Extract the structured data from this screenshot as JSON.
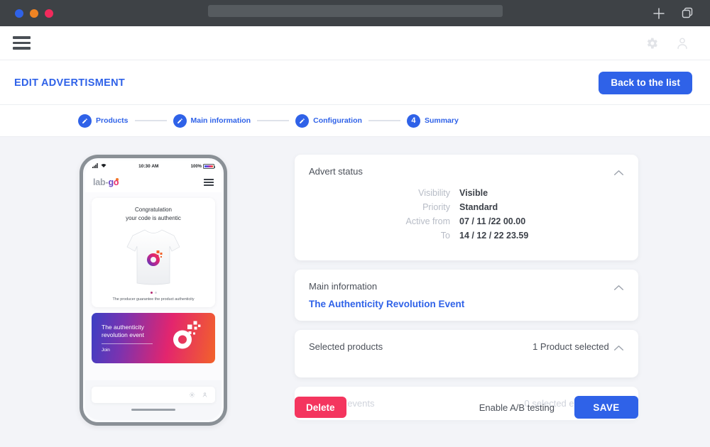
{
  "browser": {
    "traffic_lights": [
      "#2f62e8",
      "#f08423",
      "#f22a5c"
    ],
    "url_value": "",
    "new_tab_icon": "plus-icon",
    "tabs_icon": "copy-tabs-icon"
  },
  "appbar": {
    "menu_icon": "hamburger-menu-icon",
    "settings_icon": "gear-icon",
    "account_icon": "user-icon"
  },
  "header": {
    "title": "EDIT ADVERTISMENT",
    "back_button": "Back to the list",
    "accent_color": "#2f62e8"
  },
  "stepper": {
    "steps": [
      {
        "label": "Products",
        "marker": "pencil-icon",
        "done": true
      },
      {
        "label": "Main information",
        "marker": "pencil-icon",
        "done": true
      },
      {
        "label": "Configuration",
        "marker": "pencil-icon",
        "done": true
      },
      {
        "label": "Summary",
        "marker": "4",
        "done": false
      }
    ]
  },
  "phone": {
    "status_bar": {
      "time": "10:30 AM",
      "battery_text": "100%",
      "signal_icon": "signal-bars-icon",
      "wifi_icon": "wifi-icon",
      "battery_icon": "battery-icon"
    },
    "nav": {
      "logo_part1": "lab-",
      "logo_part2": "g",
      "logo_part3": "o",
      "menu_icon": "hamburger-menu-icon"
    },
    "product_card": {
      "title_line1": "Congratulation",
      "title_line2": "your code is authentic",
      "image": "tshirt-image",
      "carousel_dots": 2,
      "carousel_active": 0,
      "footer": "The producer guarantee the product authenticity"
    },
    "banner": {
      "line1": "The authenticity",
      "line2": "revolution event",
      "cta": "Join",
      "logo": "labgo-mark-icon",
      "gradient": [
        "#3b3fc4",
        "#7a33b0",
        "#e3256e",
        "#f2622a"
      ]
    },
    "bottom_bar": {
      "search_placeholder": "",
      "gear_icon": "gear-icon",
      "user_icon": "user-icon"
    }
  },
  "cards": [
    {
      "title": "Advert status",
      "value": "",
      "chevron": "chevron-up-icon",
      "rows": [
        {
          "key": "Visibility",
          "value": "Visible"
        },
        {
          "key": "Priority",
          "value": "Standard"
        },
        {
          "key": "Active from",
          "value": "07 / 11 /22 00.00"
        },
        {
          "key": "To",
          "value": "14 / 12 / 22 23.59"
        }
      ]
    },
    {
      "title": "Main information",
      "link": "The Authenticity Revolution Event",
      "chevron": "chevron-up-icon"
    },
    {
      "title": "Selected products",
      "value": "1 Product selected",
      "chevron": "chevron-up-icon"
    },
    {
      "title": "Selected events",
      "value": "0 selected events",
      "disabled": true
    }
  ],
  "actions": {
    "delete_label": "Delete",
    "ab_testing_label": "Enable A/B testing",
    "save_label": "SAVE",
    "delete_color": "#f4355e",
    "save_color": "#2f62e8"
  }
}
